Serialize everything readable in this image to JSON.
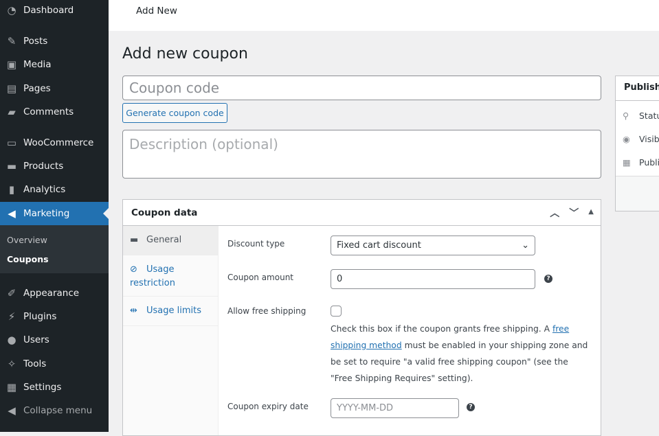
{
  "sidebar": {
    "items": [
      {
        "label": "Dashboard",
        "icon": "dashboard-icon",
        "glyph": "◔"
      },
      {
        "label": "Posts",
        "icon": "pin-icon",
        "glyph": "✎"
      },
      {
        "label": "Media",
        "icon": "media-icon",
        "glyph": "▣"
      },
      {
        "label": "Pages",
        "icon": "pages-icon",
        "glyph": "▤"
      },
      {
        "label": "Comments",
        "icon": "comment-icon",
        "glyph": "▰"
      },
      {
        "label": "WooCommerce",
        "icon": "woo-icon",
        "glyph": "▭"
      },
      {
        "label": "Products",
        "icon": "archive-icon",
        "glyph": "▬"
      },
      {
        "label": "Analytics",
        "icon": "chart-bar-icon",
        "glyph": "▮"
      },
      {
        "label": "Marketing",
        "icon": "megaphone-icon",
        "glyph": "◀"
      },
      {
        "label": "Appearance",
        "icon": "brush-icon",
        "glyph": "✐"
      },
      {
        "label": "Plugins",
        "icon": "plugin-icon",
        "glyph": "⚡"
      },
      {
        "label": "Users",
        "icon": "user-icon",
        "glyph": "●"
      },
      {
        "label": "Tools",
        "icon": "wrench-icon",
        "glyph": "✧"
      },
      {
        "label": "Settings",
        "icon": "settings-icon",
        "glyph": "▦"
      },
      {
        "label": "Collapse menu",
        "icon": "collapse-icon",
        "glyph": "◀"
      }
    ],
    "submenu": [
      "Overview",
      "Coupons"
    ]
  },
  "topbar": {
    "title": "Add New"
  },
  "page": {
    "title": "Add new coupon",
    "code_placeholder": "Coupon code",
    "generate": "Generate coupon code",
    "desc_placeholder": "Description (optional)"
  },
  "coupon_data": {
    "title": "Coupon data",
    "tabs": [
      {
        "label": "General",
        "glyph": "▬"
      },
      {
        "label": "Usage restriction",
        "glyph": "⊘"
      },
      {
        "label": "Usage limits",
        "glyph": "⇹"
      }
    ],
    "discount_type_label": "Discount type",
    "discount_type": "Fixed cart discount",
    "amount_label": "Coupon amount",
    "amount": "0",
    "free_shipping_label": "Allow free shipping",
    "free_shipping_checked": false,
    "note_pre": "Check this box if the coupon grants free shipping. A ",
    "note_link": "free shipping method",
    "note_post": " must be enabled in your shipping zone and be set to require \"a valid free shipping coupon\" (see the \"Free Shipping Requires\" setting).",
    "expiry_label": "Coupon expiry date",
    "expiry_placeholder": "YYYY-MM-DD"
  },
  "publish": {
    "title": "Publish",
    "rows": [
      "Status",
      "Visibility",
      "Publish"
    ]
  }
}
